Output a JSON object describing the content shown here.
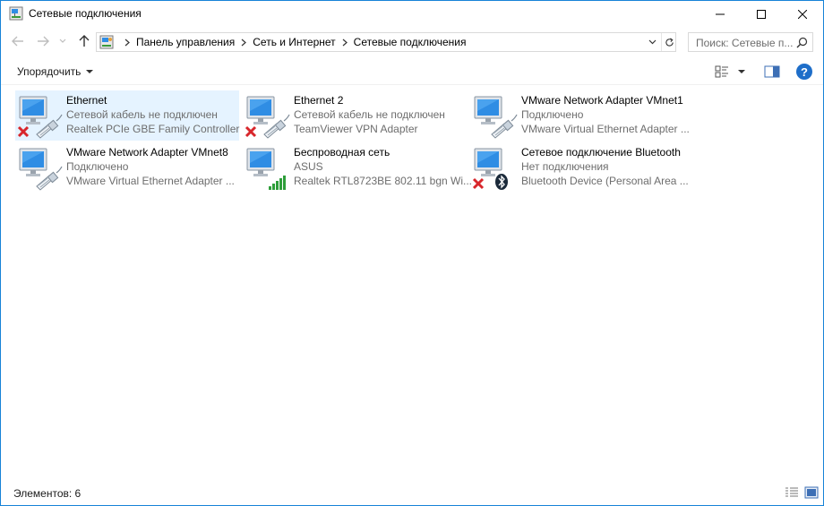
{
  "window": {
    "title": "Сетевые подключения",
    "icon": "network-connections-icon"
  },
  "address": {
    "crumbs": [
      "Панель управления",
      "Сеть и Интернет",
      "Сетевые подключения"
    ]
  },
  "search": {
    "placeholder": "Поиск: Сетевые п..."
  },
  "toolbar": {
    "organize_label": "Упорядочить"
  },
  "connections": [
    {
      "name": "Ethernet",
      "status": "Сетевой кабель не подключен",
      "device": "Realtek PCIe GBE Family Controller",
      "type": "ethernet",
      "error": true,
      "selected": true
    },
    {
      "name": "Ethernet 2",
      "status": "Сетевой кабель не подключен",
      "device": "TeamViewer VPN Adapter",
      "type": "ethernet",
      "error": true,
      "selected": false
    },
    {
      "name": "VMware Network Adapter VMnet1",
      "status": "Подключено",
      "device": "VMware Virtual Ethernet Adapter ...",
      "type": "ethernet",
      "error": false,
      "selected": false
    },
    {
      "name": "VMware Network Adapter VMnet8",
      "status": "Подключено",
      "device": "VMware Virtual Ethernet Adapter ...",
      "type": "ethernet",
      "error": false,
      "selected": false
    },
    {
      "name": "Беспроводная сеть",
      "status": "ASUS",
      "device": "Realtek RTL8723BE 802.11 bgn Wi...",
      "type": "wireless",
      "error": false,
      "selected": false
    },
    {
      "name": "Сетевое подключение Bluetooth",
      "status": "Нет подключения",
      "device": "Bluetooth Device (Personal Area ...",
      "type": "bluetooth",
      "error": true,
      "selected": false
    }
  ],
  "statusbar": {
    "count_text": "Элементов: 6"
  },
  "colors": {
    "selection": "#e5f3ff",
    "accent_border": "#1883d7",
    "secondary_text": "#6d6d6d",
    "help_blue": "#1e6ec9"
  }
}
